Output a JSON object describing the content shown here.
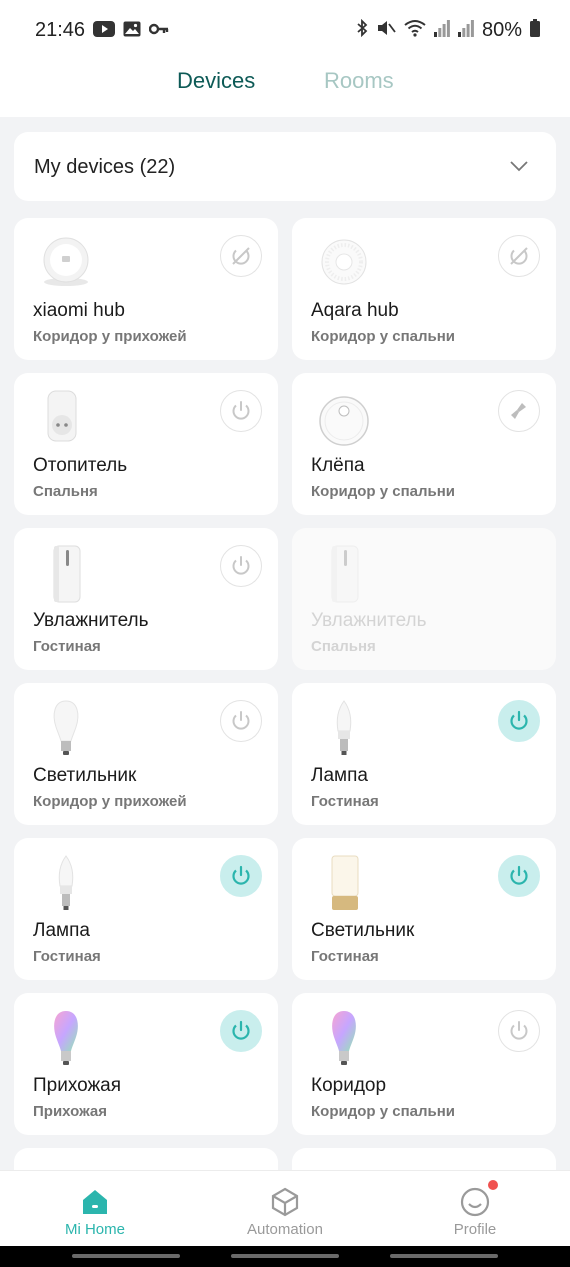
{
  "status_bar": {
    "time": "21:46",
    "battery": "80%",
    "left_icons": [
      "youtube-icon",
      "gallery-icon",
      "key-icon"
    ],
    "right_icons": [
      "bluetooth-icon",
      "mute-icon",
      "wifi-icon",
      "signal-icon",
      "signal-icon",
      "battery-icon"
    ]
  },
  "tabs": {
    "devices": "Devices",
    "rooms": "Rooms",
    "active": "Devices"
  },
  "selector": {
    "label": "My devices (22)"
  },
  "devices": [
    {
      "name": "xiaomi hub",
      "room": "Коридор у прихожей",
      "action": "offline-toggle",
      "state": "off",
      "thumb": "hub"
    },
    {
      "name": "Aqara hub",
      "room": "Коридор у спальни",
      "action": "offline-toggle",
      "state": "off",
      "thumb": "aqara"
    },
    {
      "name": "Отопитель",
      "room": "Спальня",
      "action": "power",
      "state": "off",
      "thumb": "plug"
    },
    {
      "name": "Клёпа",
      "room": "Коридор у спальни",
      "action": "clean",
      "state": "off",
      "thumb": "vacuum"
    },
    {
      "name": "Увлажнитель",
      "room": "Гостиная",
      "action": "power",
      "state": "off",
      "thumb": "humidifier"
    },
    {
      "name": "Увлажнитель",
      "room": "Спальня",
      "action": "none",
      "state": "offline",
      "thumb": "humidifier"
    },
    {
      "name": "Светильник",
      "room": "Коридор у прихожей",
      "action": "power",
      "state": "off",
      "thumb": "bulb-white"
    },
    {
      "name": "Лампа",
      "room": "Гостиная",
      "action": "power",
      "state": "on",
      "thumb": "bulb-candle"
    },
    {
      "name": "Лампа",
      "room": "Гостиная",
      "action": "power",
      "state": "on",
      "thumb": "bulb-candle"
    },
    {
      "name": "Светильник",
      "room": "Гостиная",
      "action": "power",
      "state": "on",
      "thumb": "lamp-gold"
    },
    {
      "name": "Прихожая",
      "room": "Прихожая",
      "action": "power",
      "state": "on",
      "thumb": "bulb-rgb"
    },
    {
      "name": "Коридор",
      "room": "Коридор у спальни",
      "action": "power",
      "state": "off",
      "thumb": "bulb-rgb"
    }
  ],
  "bottom_nav": {
    "items": [
      {
        "label": "Mi Home",
        "icon": "home-icon",
        "active": true
      },
      {
        "label": "Automation",
        "icon": "automation-icon",
        "active": false
      },
      {
        "label": "Profile",
        "icon": "profile-icon",
        "active": false,
        "badge": true
      }
    ]
  },
  "colors": {
    "accent": "#2bb5ad",
    "tab_active": "#0d5a56",
    "tab_inactive": "#a7c7c3",
    "power_on_bg": "#c9eeed",
    "badge": "#f0514f"
  }
}
